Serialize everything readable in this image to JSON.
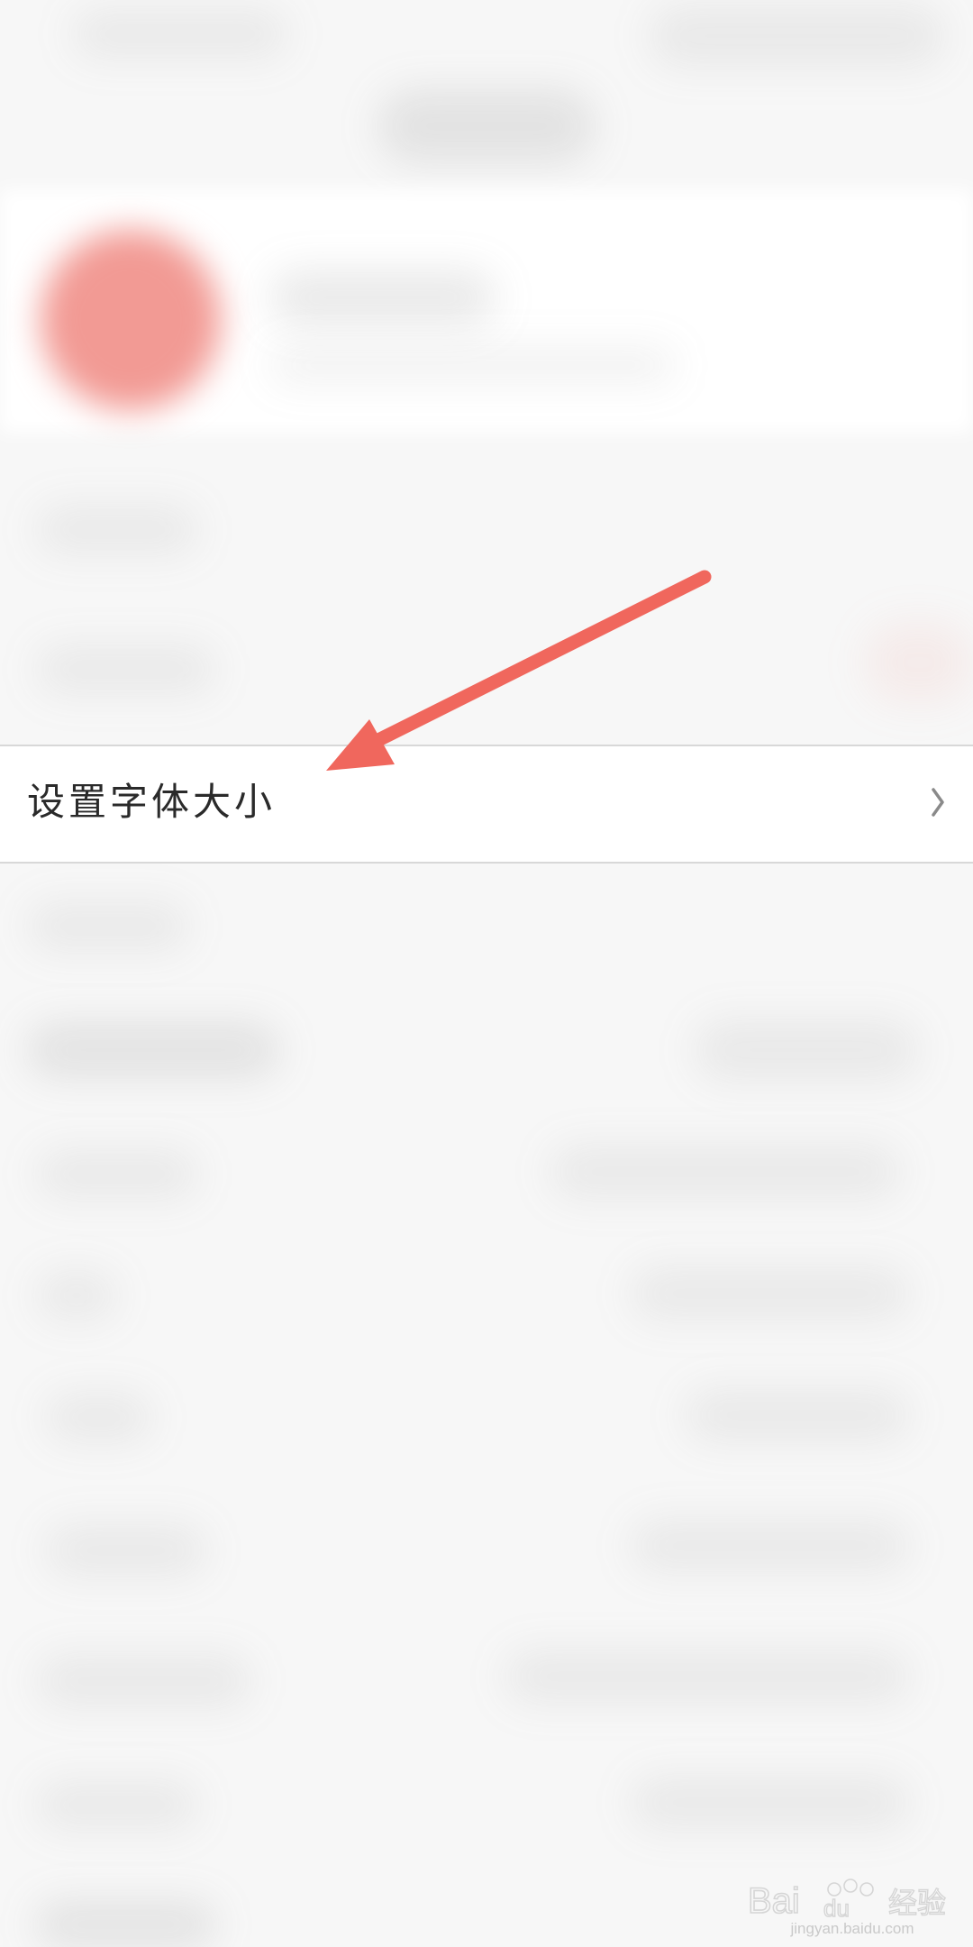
{
  "settings_row": {
    "label": "设置字体大小"
  },
  "icons": {
    "row_chevron": "chevron-right-icon",
    "annotation": "arrow-annotation-icon"
  },
  "colors": {
    "arrow": "#f0675d",
    "avatar": "#f29a94",
    "row_text": "#2a2a2a",
    "divider": "#d8d8d8"
  },
  "watermark": {
    "logo": "Bai du 经验",
    "url": "jingyan.baidu.com"
  }
}
